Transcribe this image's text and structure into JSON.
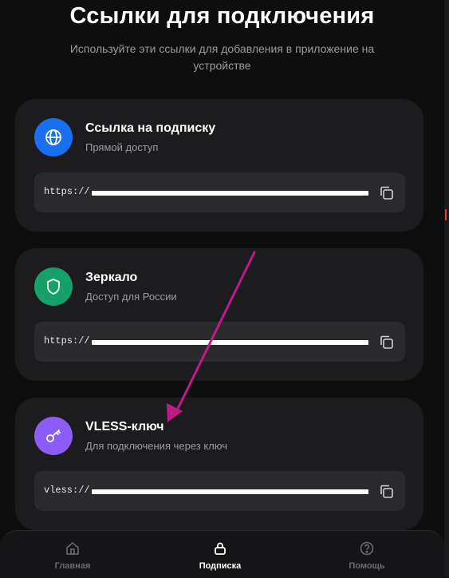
{
  "header": {
    "title": "Ссылки для подключения",
    "subtitle": "Используйте эти ссылки для добавления в приложение на устройстве"
  },
  "cards": [
    {
      "name": "Ссылка на подписку",
      "description": "Прямой доступ",
      "link_prefix": "https://",
      "icon": "globe-icon",
      "icon_color": "#1a6ff0"
    },
    {
      "name": "Зеркало",
      "description": "Доступ для России",
      "link_prefix": "https://",
      "icon": "shield-icon",
      "icon_color": "#16a06a"
    },
    {
      "name": "VLESS-ключ",
      "description": "Для подключения через ключ",
      "link_prefix": "vless://",
      "icon": "key-icon",
      "icon_color": "#8b5cf6"
    }
  ],
  "annotation": {
    "arrow_color": "#c01a8a"
  },
  "nav": {
    "items": [
      {
        "label": "Главная",
        "icon": "home-icon",
        "active": false
      },
      {
        "label": "Подписка",
        "icon": "lock-icon",
        "active": true
      },
      {
        "label": "Помощь",
        "icon": "help-icon",
        "active": false
      }
    ],
    "active_color": "#ffffff",
    "inactive_color": "#6b6b72"
  }
}
